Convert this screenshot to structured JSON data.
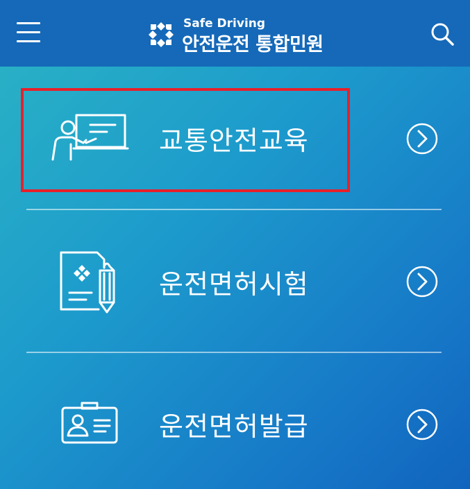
{
  "header": {
    "brand_sub": "Safe Driving",
    "brand_title": "안전운전 통합민원",
    "menu_icon": "hamburger-menu-icon",
    "search_icon": "search-icon"
  },
  "menu": [
    {
      "label": "교통안전교육",
      "icon": "classroom-teacher-icon",
      "arrow_icon": "chevron-right-circle-icon"
    },
    {
      "label": "운전면허시험",
      "icon": "exam-document-pencil-icon",
      "arrow_icon": "chevron-right-circle-icon"
    },
    {
      "label": "운전면허발급",
      "icon": "id-card-icon",
      "arrow_icon": "chevron-right-circle-icon"
    }
  ],
  "colors": {
    "header_bg": "#1569b8",
    "gradient_start": "#2bb4c4",
    "gradient_end": "#1164bd",
    "highlight_border": "#e8202a",
    "foreground": "#ffffff"
  }
}
